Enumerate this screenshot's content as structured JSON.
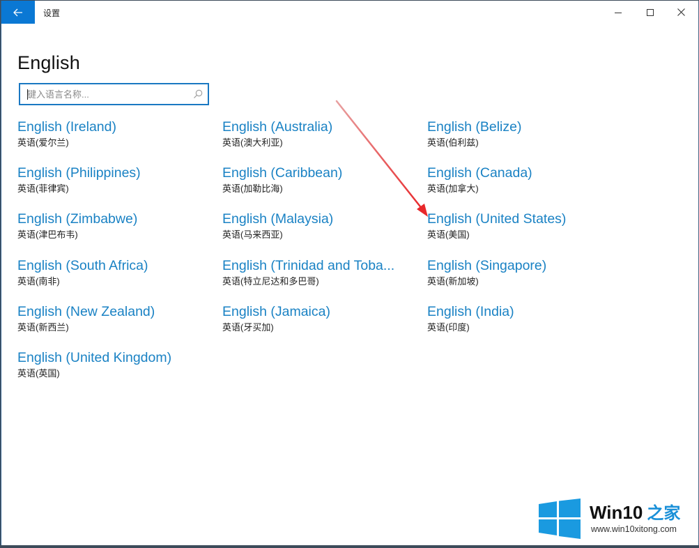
{
  "window": {
    "title": "设置",
    "controls": {
      "minimize": "minimize",
      "maximize": "maximize",
      "close": "close"
    }
  },
  "page": {
    "title": "English"
  },
  "search": {
    "value": "",
    "placeholder": "键入语言名称..."
  },
  "languages": [
    {
      "name": "English (Ireland)",
      "native": "英语(爱尔兰)"
    },
    {
      "name": "English (Australia)",
      "native": "英语(澳大利亚)"
    },
    {
      "name": "English (Belize)",
      "native": "英语(伯利兹)"
    },
    {
      "name": "English (Philippines)",
      "native": "英语(菲律宾)"
    },
    {
      "name": "English (Caribbean)",
      "native": "英语(加勒比海)"
    },
    {
      "name": "English (Canada)",
      "native": "英语(加拿大)"
    },
    {
      "name": "English (Zimbabwe)",
      "native": "英语(津巴布韦)"
    },
    {
      "name": "English (Malaysia)",
      "native": "英语(马来西亚)"
    },
    {
      "name": "English (United States)",
      "native": "英语(美国)"
    },
    {
      "name": "English (South Africa)",
      "native": "英语(南非)"
    },
    {
      "name": "English (Trinidad and Toba...",
      "native": "英语(特立尼达和多巴哥)"
    },
    {
      "name": "English (Singapore)",
      "native": "英语(新加坡)"
    },
    {
      "name": "English (New Zealand)",
      "native": "英语(新西兰)"
    },
    {
      "name": "English (Jamaica)",
      "native": "英语(牙买加)"
    },
    {
      "name": "English (India)",
      "native": "英语(印度)"
    },
    {
      "name": "English (United Kingdom)",
      "native": "英语(英国)"
    }
  ],
  "annotation": {
    "type": "red-arrow",
    "points_to": "English (United States)",
    "color": "#e8282b"
  },
  "watermark": {
    "brand": "Win10",
    "brand_cn": "之家",
    "url": "www.win10xitong.com"
  },
  "colors": {
    "accent": "#0a78d4",
    "link": "#1a82c4"
  }
}
